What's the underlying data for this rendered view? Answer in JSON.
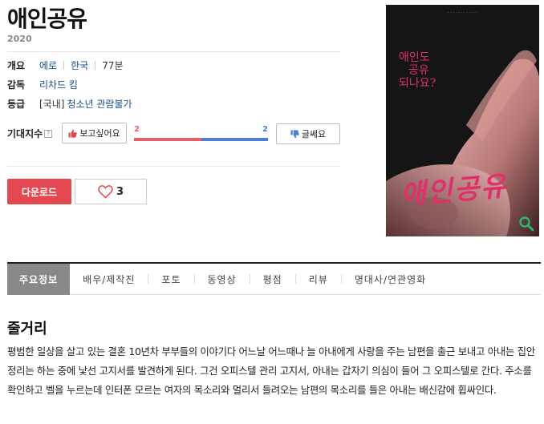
{
  "movie": {
    "title": "애인공유",
    "year": "2020",
    "overview_label": "개요",
    "genre": "에로",
    "country": "한국",
    "runtime": "77분",
    "director_label": "감독",
    "director": "리차드 킴",
    "rating_label": "등급",
    "rating_prefix": "[국내]",
    "rating": "청소년 관람불가"
  },
  "expectation": {
    "label": "기대지수",
    "help": "?",
    "want_label": "보고싶어요",
    "want_count": "2",
    "nope_label": "글쎄요",
    "nope_count": "2",
    "want_fraction": 0.5,
    "colors": {
      "want": "#e5626a",
      "nope": "#4a7fd4"
    }
  },
  "actions": {
    "download_label": "다운로드",
    "like_count": "3"
  },
  "poster": {
    "tagline_1": "애인도",
    "tagline_2": "공유",
    "tagline_3": "되나요?",
    "title_art": "애인공유"
  },
  "tabs": [
    "주요정보",
    "배우/제작진",
    "포토",
    "동영상",
    "평점",
    "리뷰",
    "명대사/연관영화"
  ],
  "synopsis": {
    "heading": "줄거리",
    "text": "평범한 일상을 살고 있는 결혼 10년차 부부들의 이야기다 어느날 어느때나 늘 아내에게 사랑을 주는 남편을 출근 보내고 아내는 집안 정리는 하는 중에 낯선 고지서를 발견하게 된다. 그건 오피스텔 관리 고지서, 아내는 갑자기 의심이 들어 그 오피스텔로 간다. 주소를 확인하고 벨을 누르는데 인터폰 모르는 여자의 목소리와 멀리서 들려오는 남편의 목소리를 들은 아내는 배신감에 휩싸인다."
  }
}
